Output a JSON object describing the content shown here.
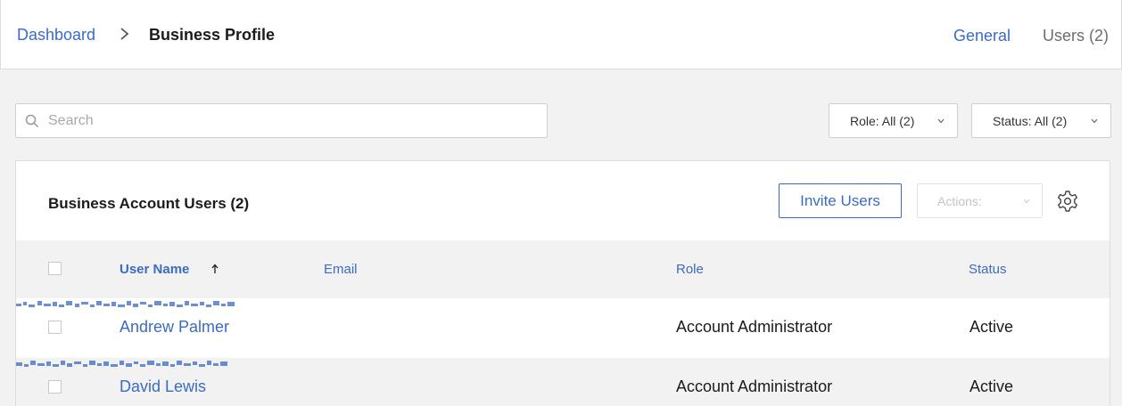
{
  "breadcrumb": {
    "root": "Dashboard",
    "current": "Business Profile"
  },
  "tabs": {
    "general": "General",
    "users": "Users (2)"
  },
  "search": {
    "placeholder": "Search",
    "value": ""
  },
  "filters": {
    "role": "Role: All (2)",
    "status": "Status: All (2)"
  },
  "card": {
    "title": "Business Account Users (2)",
    "invite_label": "Invite Users",
    "actions_label": "Actions:"
  },
  "table": {
    "columns": {
      "name": "User Name",
      "email": "Email",
      "role": "Role",
      "status": "Status"
    },
    "rows": [
      {
        "name": "Andrew Palmer",
        "role": "Account Administrator",
        "status": "Active"
      },
      {
        "name": "David Lewis",
        "role": "Account Administrator",
        "status": "Active"
      }
    ]
  },
  "colors": {
    "accent": "#3b6bc4",
    "background": "#f2f2f2",
    "border": "#dcdcdc"
  },
  "icons": [
    "chevron-right-icon",
    "search-icon",
    "chevron-down-icon",
    "gear-icon",
    "sort-ascending-icon"
  ]
}
